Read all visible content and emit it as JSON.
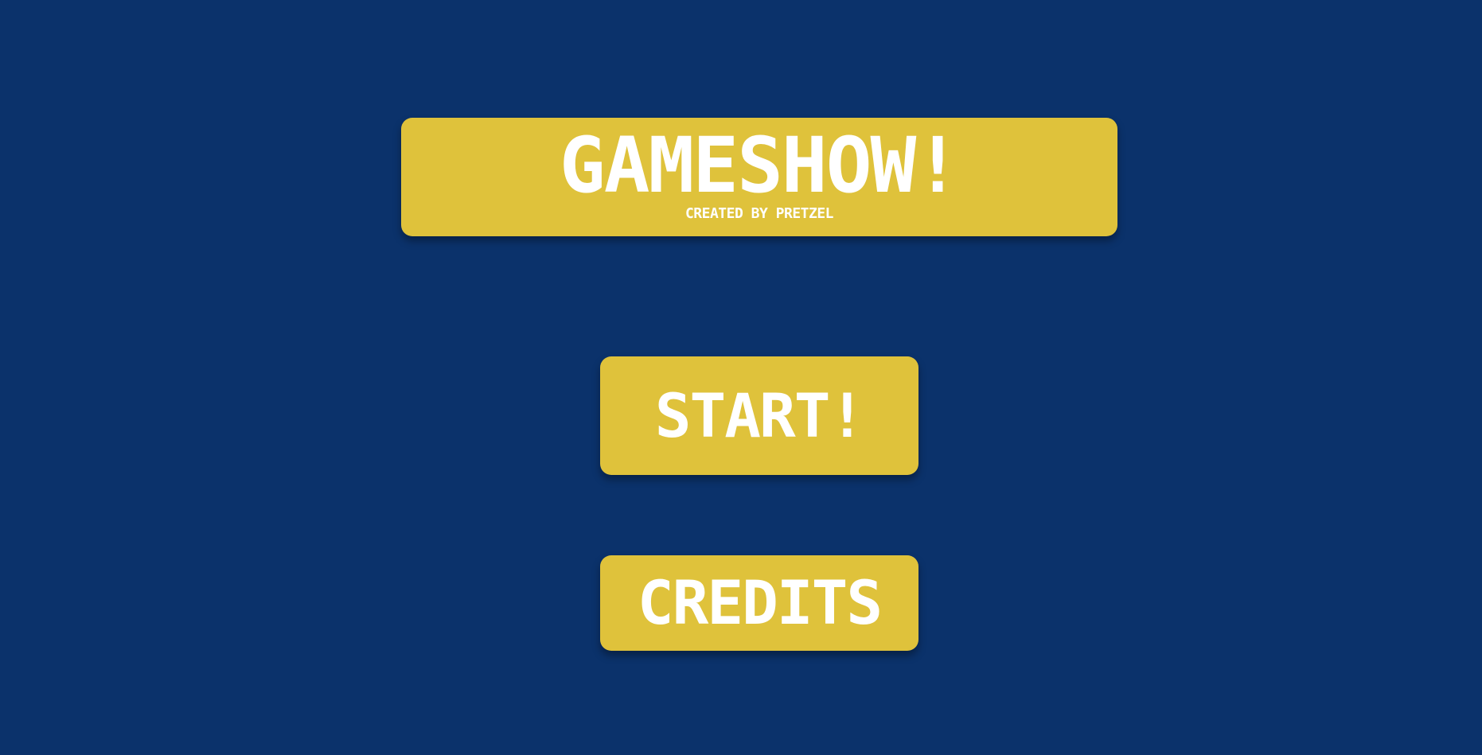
{
  "title": {
    "text": "GAMESHOW!",
    "subtitle": "CREATED BY PRETZEL"
  },
  "menu": {
    "start_label": "START!",
    "credits_label": "CREDITS"
  },
  "colors": {
    "background": "#0b326b",
    "panel": "#dfc23b",
    "text": "#ffffff"
  }
}
